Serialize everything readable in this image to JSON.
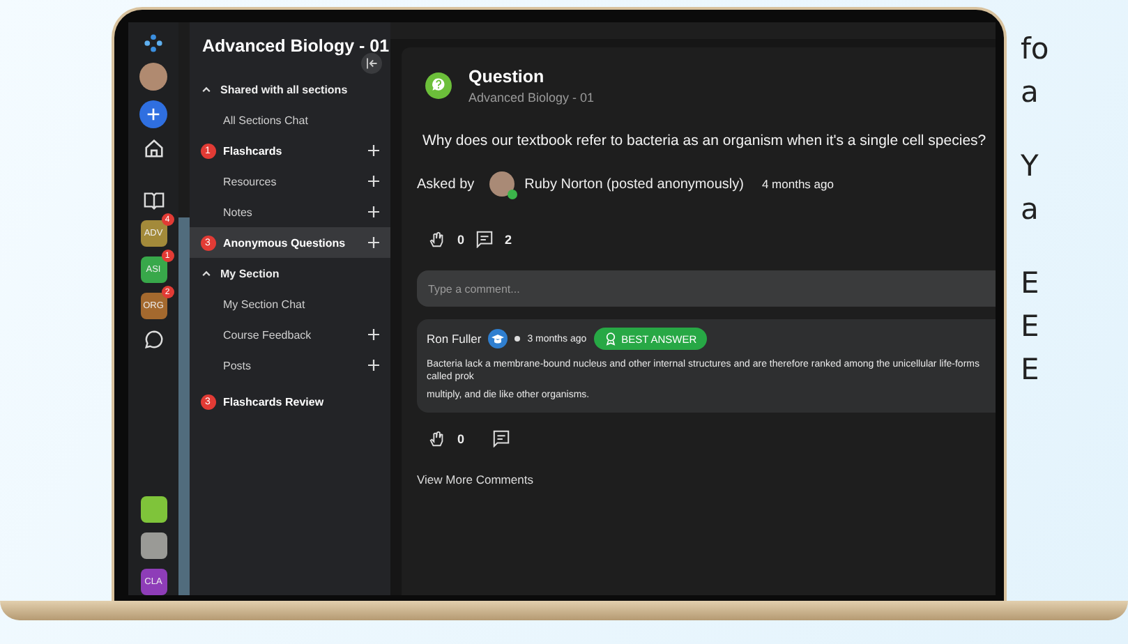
{
  "rail": {
    "courses_top": [
      {
        "label": "ADV",
        "color": "#a38a3a",
        "badge": "4"
      },
      {
        "label": "ASI",
        "color": "#38a84a",
        "badge": "1"
      },
      {
        "label": "ORG",
        "color": "#a4692e",
        "badge": "2"
      }
    ],
    "courses_bottom": [
      {
        "label": "CLA",
        "color": "#8e3db8"
      }
    ]
  },
  "sidebar": {
    "title": "Advanced Biology - 01",
    "items": [
      {
        "kind": "section",
        "label": "Shared with all sections",
        "expanded": true,
        "children": [
          {
            "label": "All Sections Chat",
            "selected": false,
            "addable": false
          },
          {
            "label": "Flashcards",
            "badge": "1",
            "selected": false,
            "addable": true
          },
          {
            "label": "Resources",
            "selected": false,
            "addable": true
          },
          {
            "label": "Notes",
            "selected": false,
            "addable": true
          },
          {
            "label": "Anonymous Questions",
            "badge": "3",
            "selected": true,
            "addable": true
          }
        ]
      },
      {
        "kind": "section",
        "label": "My Section",
        "expanded": true,
        "children": [
          {
            "label": "My Section Chat",
            "selected": false,
            "addable": false
          },
          {
            "label": "Course Feedback",
            "selected": false,
            "addable": true
          },
          {
            "label": "Posts",
            "selected": false,
            "addable": true
          }
        ]
      },
      {
        "kind": "channel",
        "label": "Flashcards Review",
        "badge": "3",
        "selected": false,
        "addable": false
      }
    ]
  },
  "post": {
    "type": "Question",
    "course": "Advanced Biology - 01",
    "text": "Why does our textbook refer to bacteria as an organism when it's a single cell species?",
    "asked_by_label": "Asked by",
    "author": "Ruby Norton (posted anonymously)",
    "author_online": true,
    "time": "4 months ago",
    "claps": "0",
    "comments": "2",
    "comment_field": {
      "placeholder": "Type a comment..."
    },
    "replies": [
      {
        "author": "Ron Fuller",
        "time": "3 months ago",
        "best_answer": true,
        "best_label": "BEST ANSWER",
        "body_lines": [
          "Bacteria lack a membrane-bound nucleus and other internal structures and are therefore ranked among the unicellular life-forms called prok",
          "multiply, and die like other organisms."
        ],
        "claps": "0"
      }
    ],
    "more_link": "View More Comments"
  },
  "side_text": [
    "fo",
    "a",
    "Y",
    "a",
    "E",
    "E",
    "E"
  ]
}
